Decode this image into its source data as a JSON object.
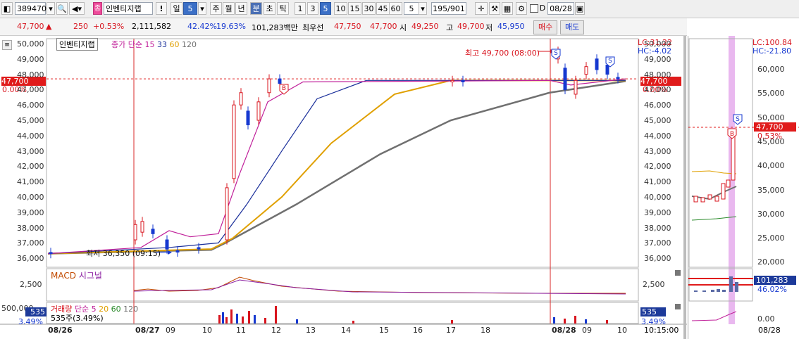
{
  "toolbar": {
    "code": "389470",
    "search_icon": "search-icon",
    "stock_name": "인벤티지랩",
    "badge": "종",
    "excl": "!",
    "period_label": "일",
    "period_value": "5",
    "buttons": [
      "주",
      "월",
      "년",
      "분",
      "초",
      "틱"
    ],
    "selected_button": "분",
    "intervals": [
      "1",
      "3",
      "5",
      "10",
      "15",
      "30",
      "45",
      "60"
    ],
    "selected_interval": "5",
    "count_value": "5",
    "page_count": "195/901",
    "checkbox_label": "D",
    "date_value": "08/28"
  },
  "quote": {
    "price": "47,700",
    "change": "250",
    "change_pct": "+0.53%",
    "volume": "2,111,582",
    "pct1": "42.42%",
    "pct2": "19.63%",
    "amount": "101,283백만",
    "best_bid_label": "최우선",
    "best_ask": "47,750",
    "best_bid": "47,700",
    "open_label": "시",
    "open": "49,250",
    "high_label": "고",
    "high": "49,700",
    "low_label": "저",
    "low": "45,950",
    "buy_button": "매수",
    "sell_button": "매도"
  },
  "price_panel": {
    "legend_name": "인벤티지랩",
    "legend_ma": "종가 단순",
    "ma_periods": [
      "15",
      "33",
      "60",
      "120"
    ],
    "ma_colors": [
      "#c0209a",
      "#1a2f9a",
      "#e0a000",
      "#707070"
    ],
    "lc": "LC:31.22",
    "hc": "HC:-4.02",
    "current_price_tag": "47,700",
    "current_pct_tag": "0.00%",
    "y_ticks": [
      "50,000",
      "49,000",
      "48,000",
      "47,000",
      "46,000",
      "45,000",
      "44,000",
      "43,000",
      "42,000",
      "41,000",
      "40,000",
      "39,000",
      "38,000",
      "37,000",
      "36,000"
    ],
    "high_annotation": "최고 49,700 (08:00)",
    "low_annotation": "최저 36,350 (09:15)",
    "marker_s": "S",
    "marker_b": "B"
  },
  "macd_panel": {
    "title": "MACD",
    "signal": "시그널",
    "y_tick": "2,500"
  },
  "volume_panel": {
    "legend_title": "거래량",
    "legend_ma": "단순",
    "ma_periods": [
      "5",
      "20",
      "60",
      "120"
    ],
    "value": "535주(3.49%)",
    "tag_value": "535",
    "tag_pct": "3.49%",
    "left_tick": "500,000"
  },
  "x_axis": {
    "labels": [
      "08/26",
      "08/27",
      "09",
      "10",
      "11",
      "12",
      "13",
      "14",
      "15",
      "16",
      "17",
      "18",
      "08/28",
      "09",
      "10"
    ],
    "time_label": "10:15:00"
  },
  "side_panel": {
    "lc": "LC:100.84",
    "hc": "HC:-21.80",
    "y_ticks": [
      "60,000",
      "55,000",
      "50,000",
      "45,000",
      "40,000",
      "35,000",
      "30,000",
      "25,000",
      "20,000"
    ],
    "price_tag": "47,700",
    "pct_tag": "0.53%",
    "vol_tag": "101,283",
    "vol_pct_tag": "46.02%",
    "lower_ticks": [
      "0.00"
    ],
    "date_label": "08/28",
    "marker_s": "S",
    "marker_b": "B"
  },
  "colors": {
    "up": "#d8141e",
    "down": "#1638d0",
    "highlight": "#e9b8ef"
  }
}
